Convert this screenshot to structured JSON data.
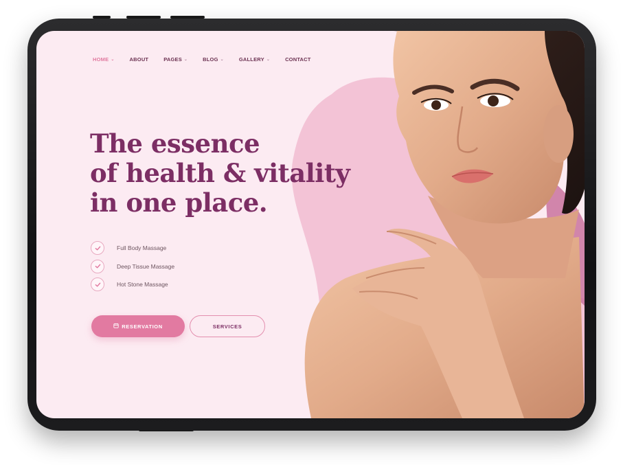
{
  "nav": {
    "items": [
      {
        "label": "HOME",
        "active": true,
        "has_dropdown": true
      },
      {
        "label": "ABOUT",
        "active": false,
        "has_dropdown": false
      },
      {
        "label": "PAGES",
        "active": false,
        "has_dropdown": true
      },
      {
        "label": "BLOG",
        "active": false,
        "has_dropdown": true
      },
      {
        "label": "GALLERY",
        "active": false,
        "has_dropdown": true
      },
      {
        "label": "CONTACT",
        "active": false,
        "has_dropdown": false
      }
    ]
  },
  "hero": {
    "headline_lines": [
      "The essence",
      "of health & vitality",
      "in one place."
    ],
    "features": [
      "Full Body Massage",
      "Deep Tissue Massage",
      "Hot Stone Massage"
    ],
    "primary_button": {
      "label": "RESERVATION",
      "icon": "calendar-icon"
    },
    "secondary_button": {
      "label": "SERVICES"
    }
  },
  "colors": {
    "background": "#fcebf2",
    "accent": "#e27aa1",
    "headline": "#7c2e64",
    "blob": "#f3c3d6",
    "device_frame": "#1c1c1e"
  },
  "icons": {
    "feature_check": "check-icon",
    "dropdown": "chevron-down-icon",
    "hero_image": "woman-portrait-photo"
  }
}
